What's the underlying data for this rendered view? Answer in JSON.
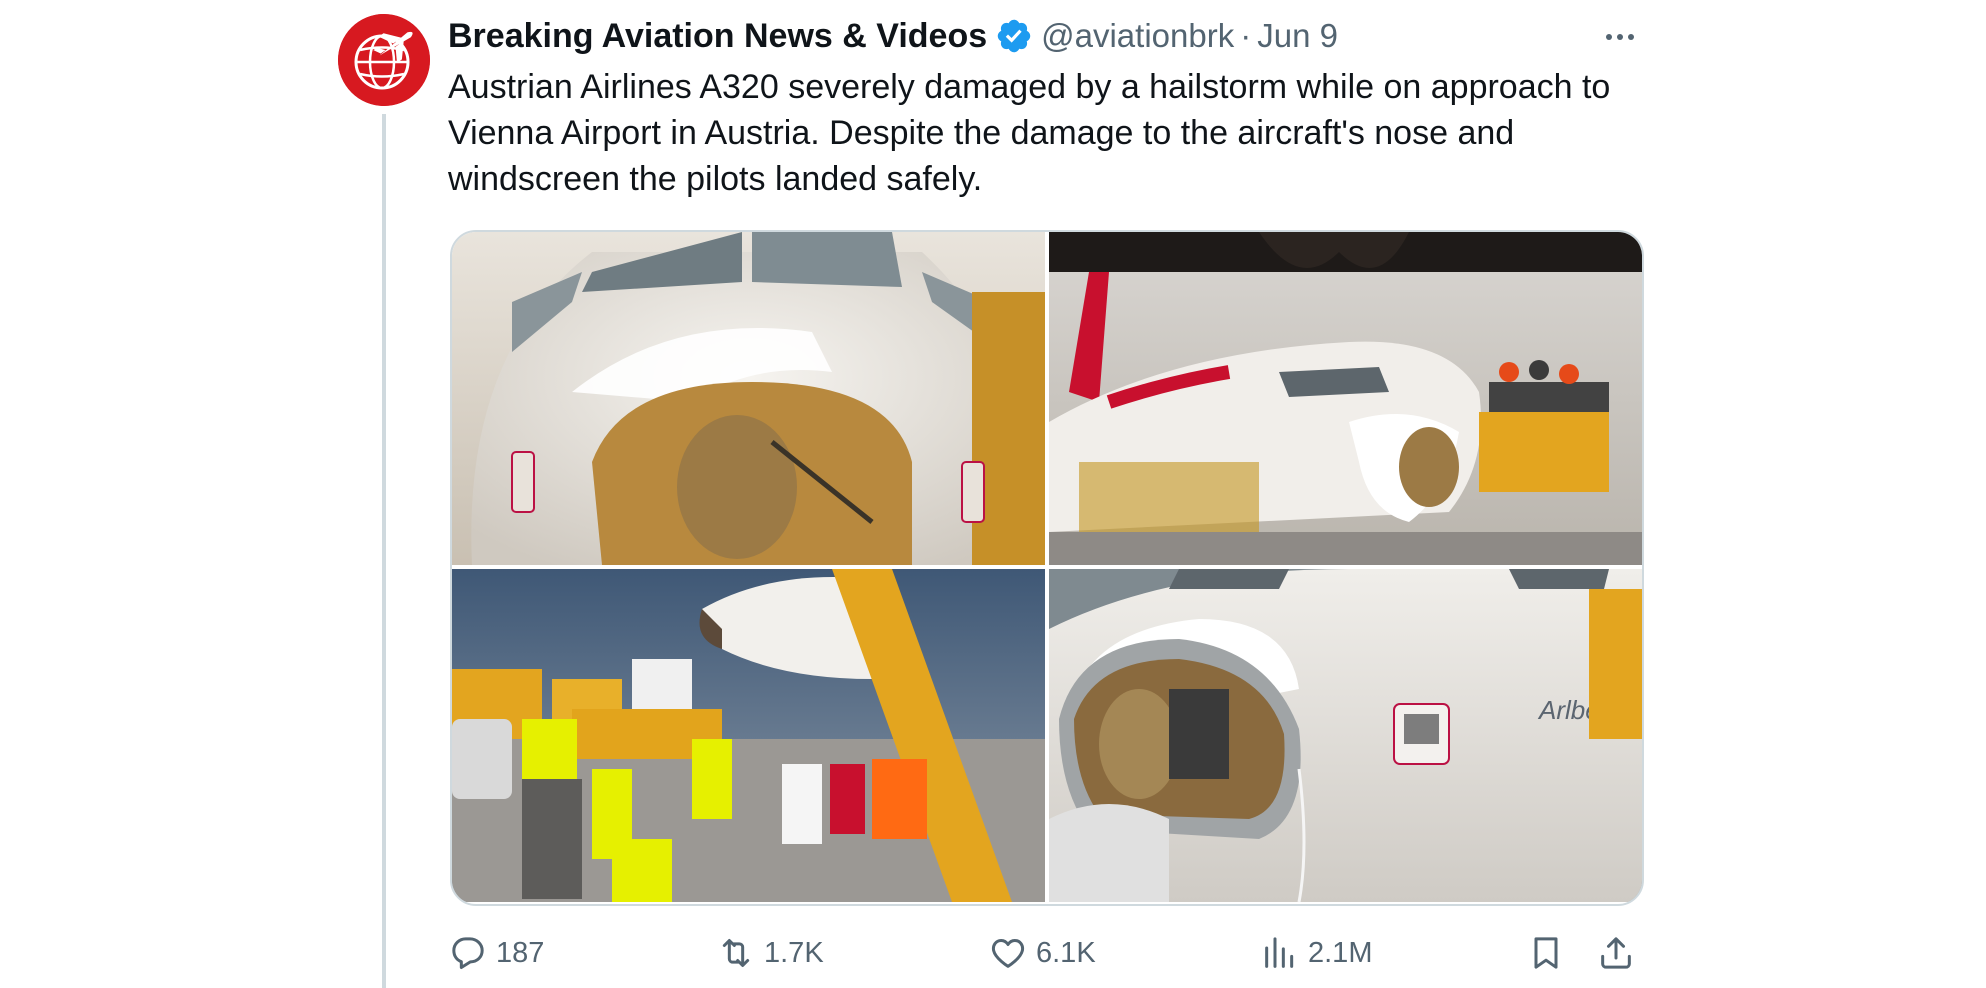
{
  "author": {
    "display_name": "Breaking Aviation News & Videos",
    "handle": "@aviationbrk",
    "separator": "·",
    "date": "Jun 9",
    "verified": true,
    "avatar_icon": "globe-plane-logo",
    "avatar_color": "#d71920"
  },
  "tweet": {
    "text": "Austrian Airlines A320 severely damaged by a hailstorm while on approach to Vienna Airport in Austria. Despite the damage to the aircraft's nose and windscreen the pilots landed safely."
  },
  "media": {
    "photos": [
      {
        "subject": "damaged-nose-closeup-photo"
      },
      {
        "subject": "aircraft-at-gate-photo"
      },
      {
        "subject": "ground-crew-stairs-photo"
      },
      {
        "subject": "nose-cone-side-photo"
      }
    ]
  },
  "actions": {
    "replies": "187",
    "reposts": "1.7K",
    "likes": "6.1K",
    "views": "2.1M"
  },
  "colors": {
    "text": "#0f1419",
    "secondary": "#536471",
    "verified": "#1d9bf0",
    "border": "#cfd9de"
  }
}
